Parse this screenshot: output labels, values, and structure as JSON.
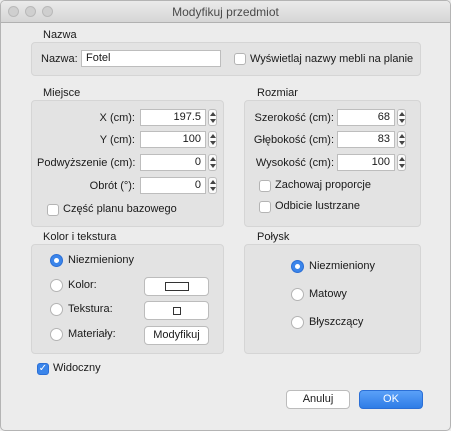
{
  "window": {
    "title": "Modyfikuj przedmiot"
  },
  "name_section": {
    "title": "Nazwa",
    "label": "Nazwa:",
    "value": "Fotel",
    "show_names_label": "Wyświetlaj nazwy mebli na planie",
    "show_names_checked": false
  },
  "location": {
    "title": "Miejsce",
    "x_label": "X (cm):",
    "x_value": "197.5",
    "y_label": "Y (cm):",
    "y_value": "100",
    "elevation_label": "Podwyższenie (cm):",
    "elevation_value": "0",
    "angle_label": "Obrót (°):",
    "angle_value": "0",
    "base_plan_label": "Część planu bazowego",
    "base_plan_checked": false
  },
  "size": {
    "title": "Rozmiar",
    "width_label": "Szerokość (cm):",
    "width_value": "68",
    "depth_label": "Głębokość (cm):",
    "depth_value": "83",
    "height_label": "Wysokość (cm):",
    "height_value": "100",
    "keep_proportions_label": "Zachowaj proporcje",
    "keep_proportions_checked": false,
    "mirror_label": "Odbicie lustrzane",
    "mirror_checked": false
  },
  "color_texture": {
    "title": "Kolor i tekstura",
    "unchanged_label": "Niezmieniony",
    "color_label": "Kolor:",
    "texture_label": "Tekstura:",
    "materials_label": "Materiały:",
    "modify_button": "Modyfikuj",
    "selected": "unchanged"
  },
  "shininess": {
    "title": "Połysk",
    "unchanged_label": "Niezmieniony",
    "matt_label": "Matowy",
    "shiny_label": "Błyszczący",
    "selected": "unchanged"
  },
  "visible": {
    "label": "Widoczny",
    "checked": true
  },
  "buttons": {
    "cancel": "Anuluj",
    "ok": "OK"
  },
  "colors": {
    "accent": "#3b85ea",
    "group_bg": "#e3e3e3",
    "window_bg": "#ececec"
  }
}
